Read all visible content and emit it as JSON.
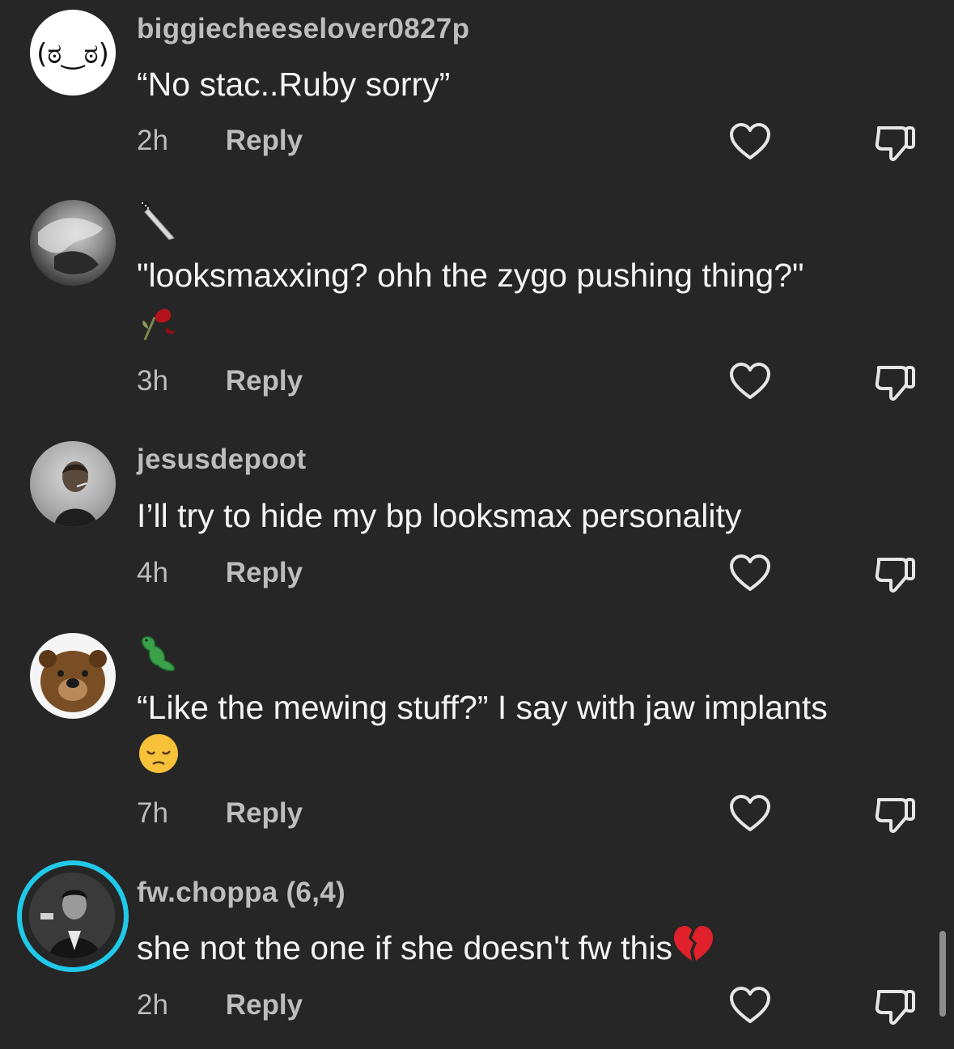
{
  "comments": [
    {
      "username": "biggiecheeselover0827p",
      "text": "“No stac..Ruby sorry”",
      "time": "2h",
      "reply": "Reply",
      "avatar": "lenny-face-avatar"
    },
    {
      "username": "",
      "username_icon": "knife-emoji",
      "text": "\"looksmaxxing? ohh the zygo pushing thing?\"",
      "text_emoji": "wilted-rose-emoji",
      "time": "3h",
      "reply": "Reply",
      "avatar": "grey-hair-person-avatar"
    },
    {
      "username": "jesusdepoot",
      "text": "I’ll try to hide my bp looksmax personality",
      "time": "4h",
      "reply": "Reply",
      "avatar": "smoking-man-avatar"
    },
    {
      "username": "",
      "username_icon": "crocodile-emoji",
      "text": "“Like the mewing stuff?” I say with jaw implants",
      "text_emoji": "pensive-face-emoji",
      "time": "7h",
      "reply": "Reply",
      "avatar": "bear-avatar"
    },
    {
      "username": "fw.choppa (6,4)",
      "text": "she not the one if she doesn't fw this",
      "text_emoji": "broken-heart-emoji",
      "time": "2h",
      "reply": "Reply",
      "avatar": "scarface-avatar-story-ring"
    }
  ],
  "icons": {
    "like": "heart-outline-icon",
    "dislike": "thumbs-down-outline-icon"
  },
  "colors": {
    "background": "#262626",
    "text": "#f4f4f4",
    "secondary": "#bdbdbd",
    "story_ring": "#20c9e8"
  }
}
